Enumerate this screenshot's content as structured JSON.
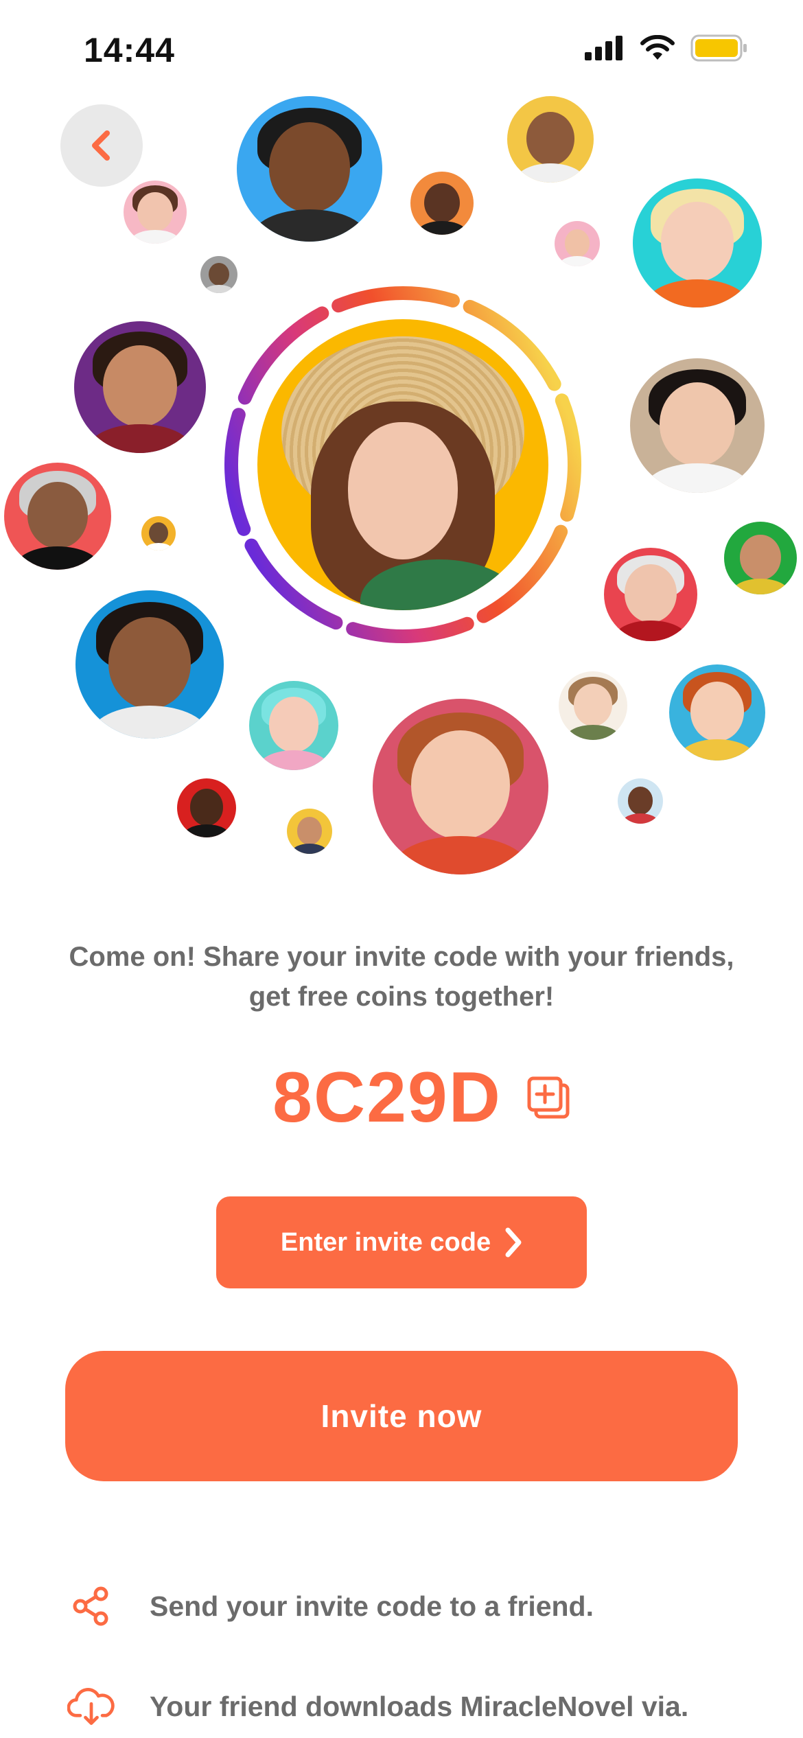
{
  "status_bar": {
    "time": "14:44"
  },
  "invite": {
    "message": "Come on! Share your invite code with your friends, get free coins together!",
    "code": "8C29D",
    "enter_code_label": "Enter invite code",
    "invite_now_label": "Invite now"
  },
  "steps": [
    {
      "icon": "share-icon",
      "text": "Send your invite code to a friend."
    },
    {
      "icon": "cloud-download-icon",
      "text": "Your friend downloads MiracleNovel via."
    }
  ],
  "colors": {
    "accent": "#fc6b43",
    "text_gray": "#6b6b6b",
    "battery": "#f7c600",
    "back_button_bg": "#e9e9e9"
  }
}
